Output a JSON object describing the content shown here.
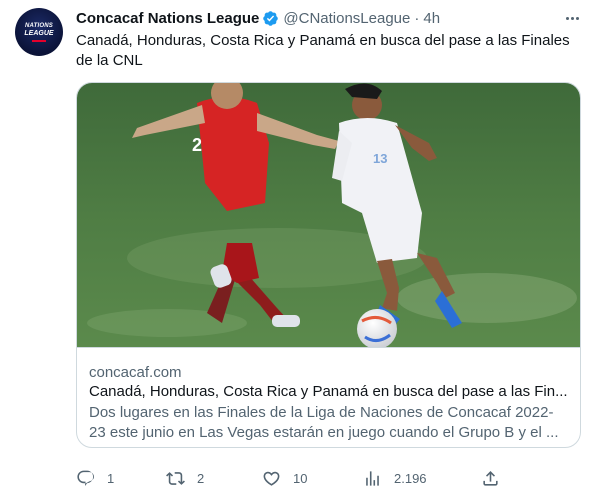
{
  "account": {
    "name": "Concacaf Nations League",
    "handle": "@CNationsLeague",
    "separator": "·",
    "time": "4h",
    "avatar_text_line1": "NATIONS",
    "avatar_text_line2": "LEAGUE"
  },
  "tweet": {
    "text": "Canadá, Honduras, Costa Rica y Panamá en busca del pase a las Finales de la CNL"
  },
  "card": {
    "domain": "concacaf.com",
    "title": "Canadá, Honduras, Costa Rica y Panamá en busca del pase a las Fin...",
    "description": "Dos lugares en las Finales de la Liga de Naciones de Concacaf 2022-23 este junio en Las Vegas estarán en juego cuando el Grupo B y el ...",
    "photo": {
      "player_red_number": "2",
      "player_white_number": "13"
    }
  },
  "actions": {
    "replies": "1",
    "retweets": "2",
    "likes": "10",
    "views": "2.196"
  },
  "colors": {
    "verified_blue": "#1d9bf0",
    "text_primary": "#0f1419",
    "text_secondary": "#536471",
    "border": "#cfd9de"
  },
  "icons": [
    "verified-badge-icon",
    "more-options-icon",
    "reply-icon",
    "retweet-icon",
    "like-icon",
    "views-icon",
    "share-icon"
  ]
}
